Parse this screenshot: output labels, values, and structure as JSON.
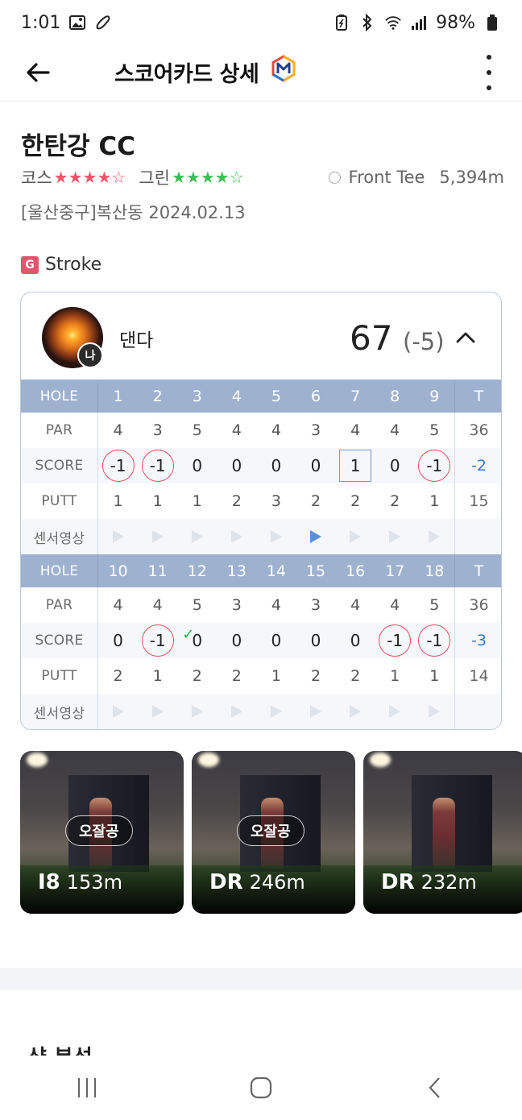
{
  "status": {
    "time": "1:01",
    "battery": "98%"
  },
  "header": {
    "title": "스코어카드 상세"
  },
  "course": {
    "name": "한탄강 CC",
    "course_label": "코스",
    "course_stars": 4,
    "green_label": "그린",
    "green_stars": 4,
    "max_stars": 5,
    "tee": "Front Tee",
    "distance": "5,394m",
    "location": "[울산중구]복산동",
    "date": "2024.02.13"
  },
  "mode": {
    "badge": "G",
    "label": "Stroke"
  },
  "player": {
    "name": "댄다",
    "badge": "나",
    "total": "67",
    "over_par": "(-5)"
  },
  "scorecard": {
    "labels": {
      "hole": "HOLE",
      "par": "PAR",
      "score": "SCORE",
      "putt": "PUTT",
      "video": "센서영상",
      "total": "T"
    },
    "front": {
      "holes": [
        "1",
        "2",
        "3",
        "4",
        "5",
        "6",
        "7",
        "8",
        "9"
      ],
      "par": [
        "4",
        "3",
        "5",
        "4",
        "4",
        "3",
        "4",
        "4",
        "5"
      ],
      "par_total": "36",
      "score": [
        "-1",
        "-1",
        "0",
        "0",
        "0",
        "0",
        "1",
        "0",
        "-1"
      ],
      "score_total": "-2",
      "putt": [
        "1",
        "1",
        "1",
        "2",
        "3",
        "2",
        "2",
        "2",
        "1"
      ],
      "putt_total": "15",
      "video_active": [
        false,
        false,
        false,
        false,
        false,
        true,
        false,
        false,
        false
      ]
    },
    "back": {
      "holes": [
        "10",
        "11",
        "12",
        "13",
        "14",
        "15",
        "16",
        "17",
        "18"
      ],
      "par": [
        "4",
        "4",
        "5",
        "3",
        "4",
        "3",
        "4",
        "4",
        "5"
      ],
      "par_total": "36",
      "score": [
        "0",
        "-1",
        "0",
        "0",
        "0",
        "0",
        "0",
        "-1",
        "-1"
      ],
      "score_total": "-3",
      "putt": [
        "2",
        "1",
        "2",
        "2",
        "1",
        "2",
        "2",
        "1",
        "1"
      ],
      "putt_total": "14",
      "video_active": [
        false,
        false,
        false,
        false,
        false,
        false,
        false,
        false,
        false
      ]
    }
  },
  "shots": [
    {
      "tag": "오잘공",
      "club": "I8",
      "distance": "153m"
    },
    {
      "tag": "오잘공",
      "club": "DR",
      "distance": "246m"
    },
    {
      "tag": "",
      "club": "DR",
      "distance": "232m"
    }
  ],
  "next_section": {
    "title": "샷 분석"
  },
  "colors": {
    "header_blue": "#9eb1cf",
    "birdie_red": "#e25560",
    "star_red": "#f0566a",
    "star_green": "#3cbf56",
    "accent_blue": "#3a78c8"
  }
}
